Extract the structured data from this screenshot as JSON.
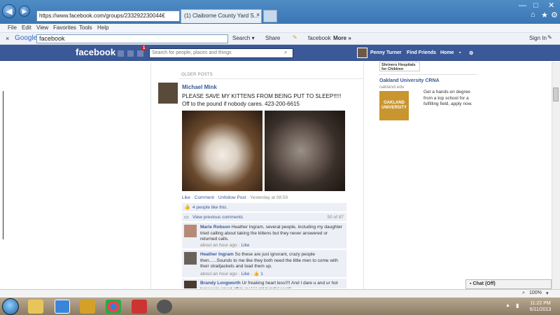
{
  "browser": {
    "address": "https://www.facebook.com/groups/233292230044€",
    "tab_title": "(1) Claiborne County Yard S...",
    "menu": [
      "File",
      "Edit",
      "View",
      "Favorites",
      "Tools",
      "Help"
    ],
    "google": {
      "logo": "Google",
      "query": "facebook",
      "search_label": "Search",
      "share_label": "Share",
      "bookmark_label": "facebook",
      "more_label": "More",
      "signin_label": "Sign In"
    },
    "status": {
      "zoom": "100%"
    }
  },
  "fb": {
    "logo": "facebook",
    "notif_count": "1",
    "search_placeholder": "Search for people, places and things",
    "user": "Penny Turner",
    "find_friends": "Find Friends",
    "home": "Home"
  },
  "feed": {
    "section_label": "OLDER POSTS",
    "post": {
      "author": "Michael Mink",
      "text": "PLEASE SAVE MY KITTENS FROM BEING PUT TO SLEEP!!!!! Off to the pound if nobody cares. 423-200-6615",
      "actions": [
        "Like",
        "Comment",
        "Unfollow Post"
      ],
      "time": "Yesterday at 08:59",
      "likes": "4 people like this.",
      "view_previous": "View previous comments",
      "count": "50 of 87"
    },
    "comments": [
      {
        "author": "Marie Robson",
        "text": "Heather Ingram, several people, including my daughter tried calling about taking the kittens but they never answered or returned calls.",
        "time": "about an hour ago",
        "action": "Like"
      },
      {
        "author": "Heather Ingram",
        "text": "So these are just ignorant, crazy people then......Sounds to me like they both need the little men to come with their straitjackets and load them up.",
        "time": "about an hour ago",
        "action": "Like",
        "likes": "1"
      },
      {
        "author": "Brandy Longworth",
        "text": "Ur freaking heart less!!!! And I dare u and ur hot temper to smart off to me! U old hateful ass!!!",
        "time": "",
        "action": ""
      }
    ]
  },
  "ads": {
    "ad1_title": "Shriners Hospitals for Children",
    "ad2_title": "Oakland University CRNA",
    "ad2_domain": "oakland.edu",
    "ad2_text": "Get a hands-on degree from a top school for a fulfilling field, apply now.",
    "ad2_logo": "OAKLAND UNIVERSITY"
  },
  "chat": {
    "label": "Chat (Off)"
  },
  "clock": {
    "time": "11:22 PM",
    "date": "6/11/2013"
  }
}
